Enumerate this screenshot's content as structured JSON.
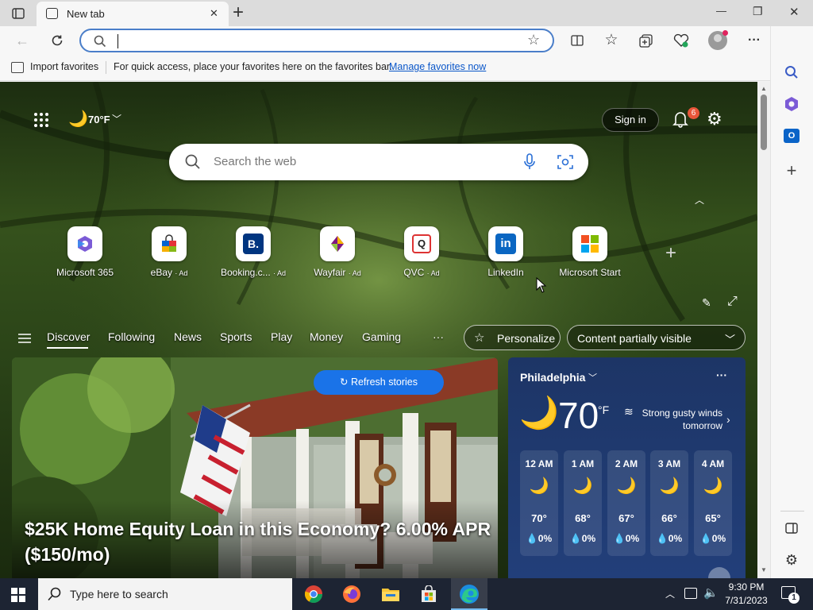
{
  "browser": {
    "tab_title": "New tab",
    "address_value": "",
    "close_label": "✕",
    "minimize_label": "—",
    "restore_label": "❐",
    "window_close_label": "✕"
  },
  "favorites_bar": {
    "import_label": "Import favorites",
    "message": "For quick access, place your favorites here on the favorites bar.",
    "manage_link": "Manage favorites now"
  },
  "header": {
    "weather_temp": "70°F",
    "sign_in_label": "Sign in",
    "notification_count": "6"
  },
  "search": {
    "placeholder": "Search the web"
  },
  "quick_links": [
    {
      "label": "Microsoft 365"
    },
    {
      "label": "eBay",
      "ad": "· Ad"
    },
    {
      "label": "Booking.c...",
      "ad": "· Ad"
    },
    {
      "label": "Wayfair",
      "ad": "· Ad"
    },
    {
      "label": "QVC",
      "ad": "· Ad"
    },
    {
      "label": "LinkedIn"
    },
    {
      "label": "Microsoft Start"
    }
  ],
  "feed_nav": {
    "items": [
      "Discover",
      "Following",
      "News",
      "Sports",
      "Play",
      "Money",
      "Gaming"
    ],
    "more_label": "···",
    "personalize_label": "Personalize",
    "content_visibility_label": "Content partially visible"
  },
  "hero_story": {
    "refresh_label": "Refresh stories",
    "headline": "$25K Home Equity Loan in this Economy? 6.00% APR ($150/mo)"
  },
  "weather_card": {
    "city": "Philadelphia",
    "current_temp": "70",
    "unit": "°F",
    "alert": "Strong gusty winds tomorrow",
    "more_label": "···",
    "hourly": [
      {
        "hour": "12 AM",
        "temp": "70°",
        "precip": "0%"
      },
      {
        "hour": "1 AM",
        "temp": "68°",
        "precip": "0%"
      },
      {
        "hour": "2 AM",
        "temp": "67°",
        "precip": "0%"
      },
      {
        "hour": "3 AM",
        "temp": "66°",
        "precip": "0%"
      },
      {
        "hour": "4 AM",
        "temp": "65°",
        "precip": "0%"
      }
    ]
  },
  "taskbar": {
    "search_placeholder": "Type here to search",
    "time": "9:30 PM",
    "date": "7/31/2023",
    "notification_count": "1"
  },
  "colors": {
    "accent": "#0067c0",
    "refresh_button": "#1a73e8",
    "weather_card_bg": "#1d3566",
    "notification_badge": "#e8563a"
  }
}
